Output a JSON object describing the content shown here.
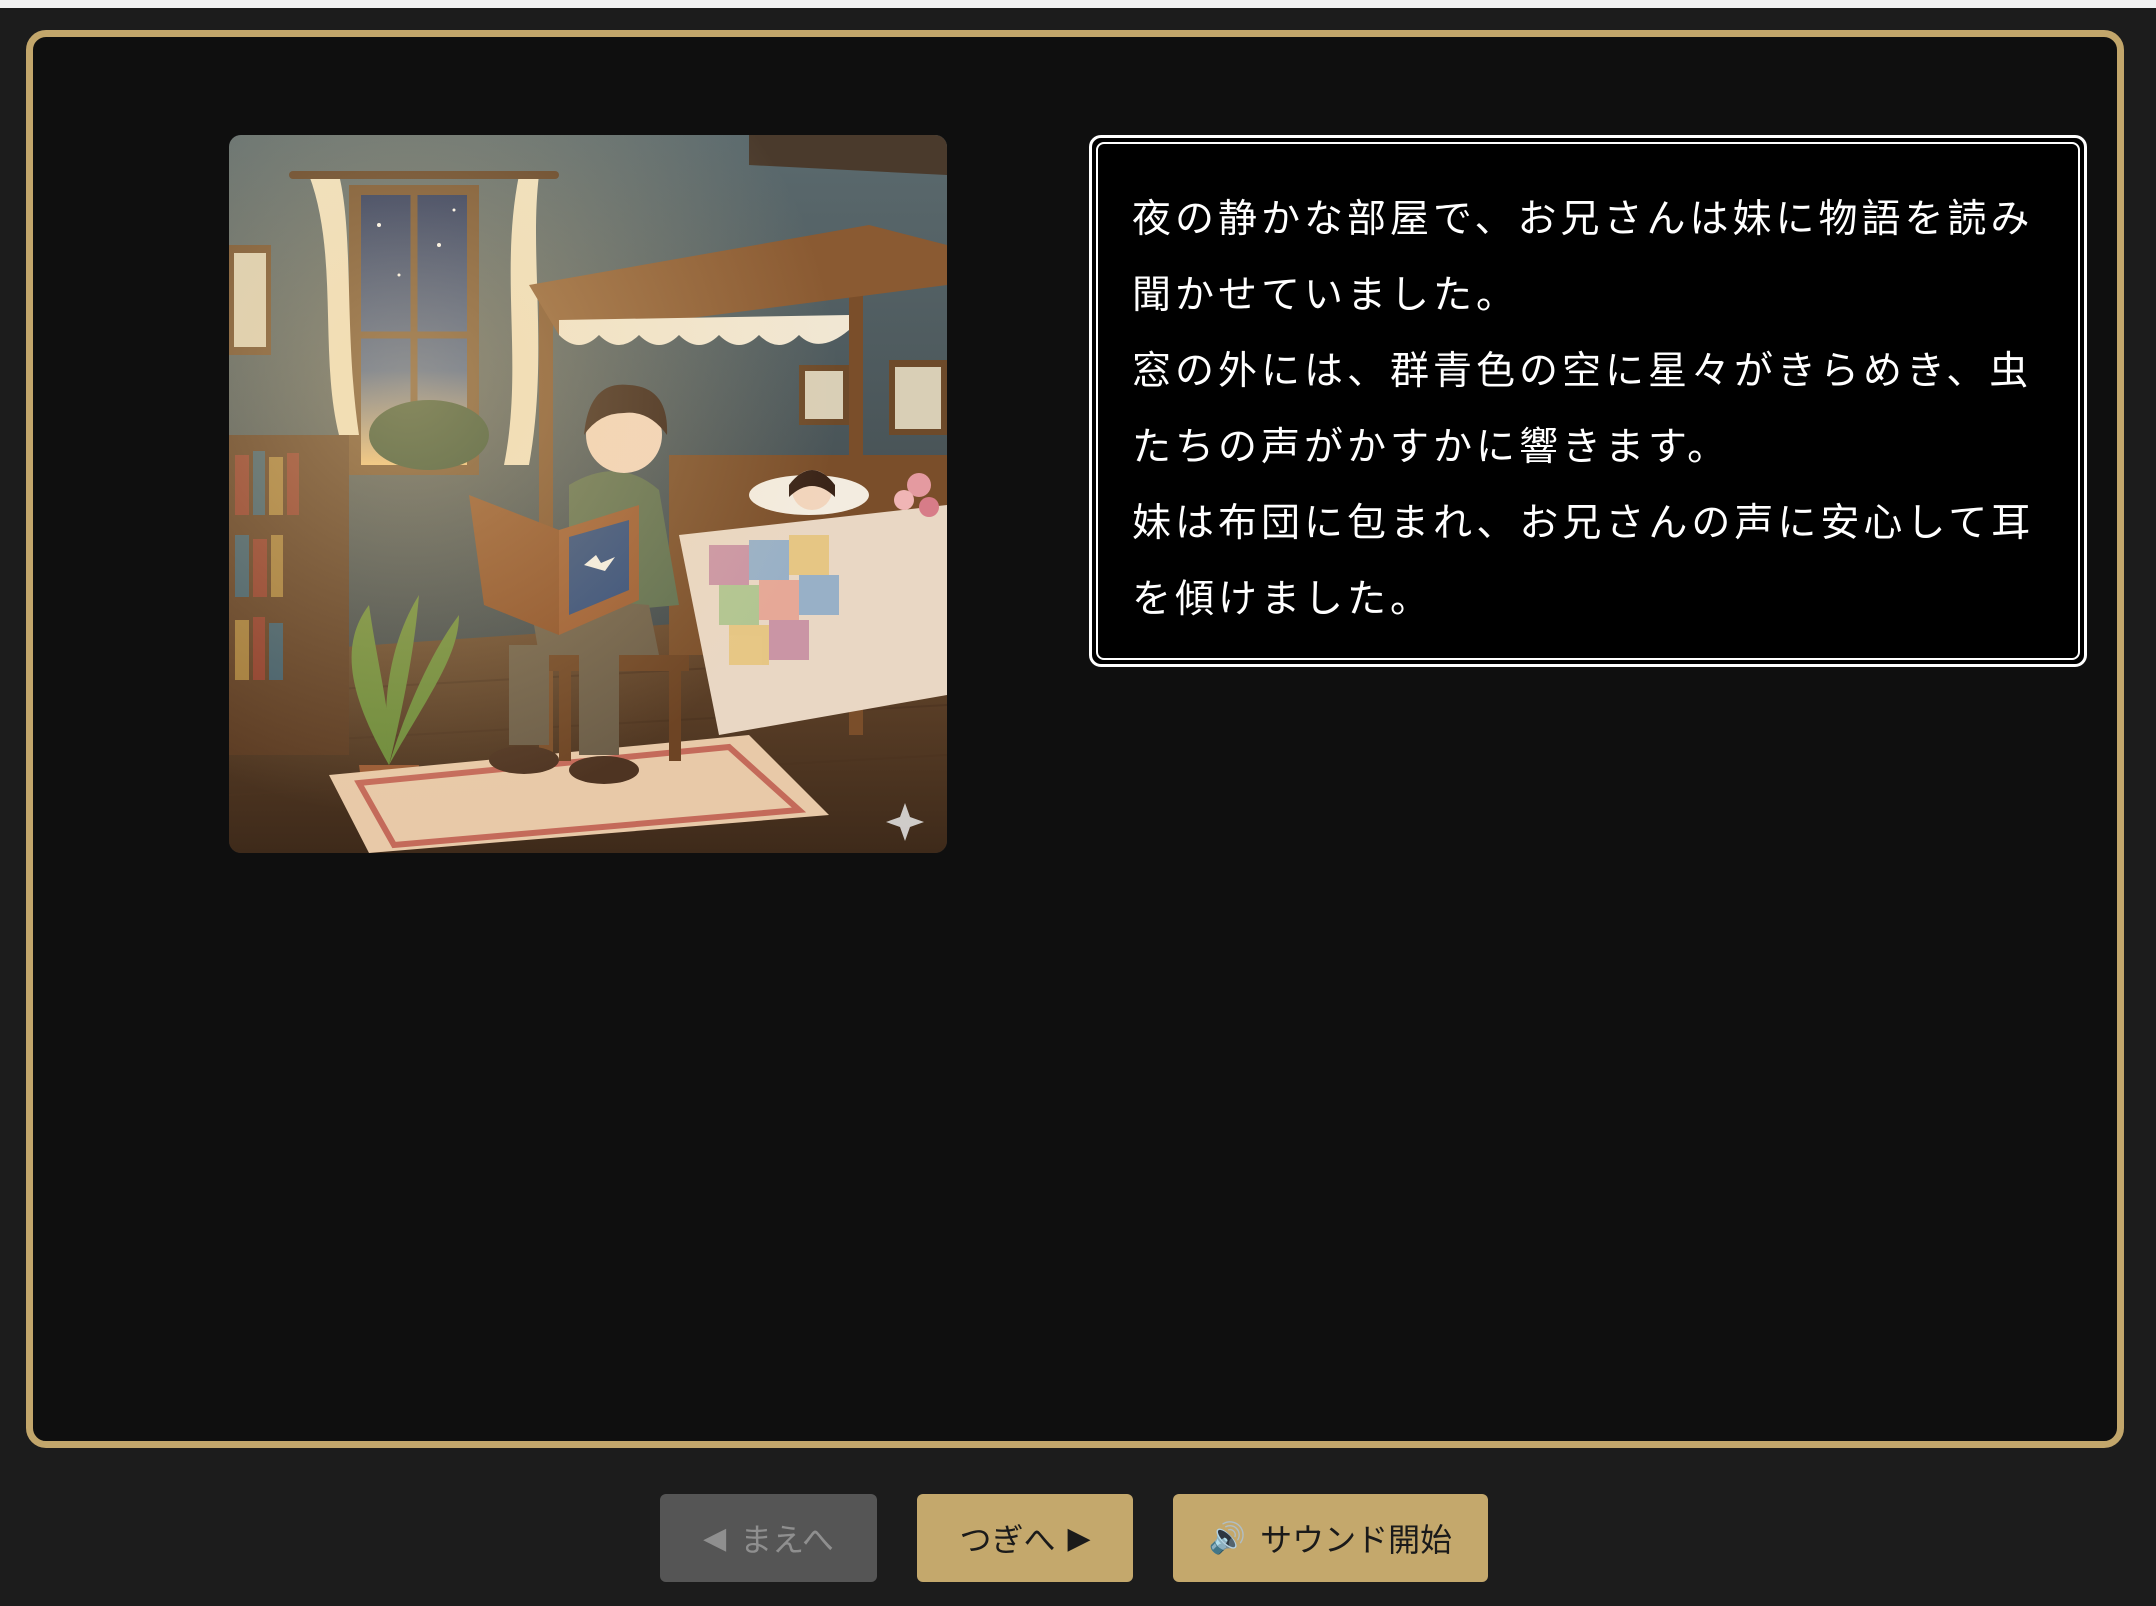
{
  "story": {
    "lines": [
      "夜の静かな部屋で、お兄さんは妹に物語を読み",
      "聞かせていました。",
      "窓の外には、群青色の空に星々がきらめき、虫",
      "たちの声がかすかに響きます。",
      "妹は布団に包まれ、お兄さんの声に安心して耳",
      "を傾けました。"
    ]
  },
  "controls": {
    "prev": {
      "icon": "◀",
      "label": "まえへ",
      "enabled": false
    },
    "next": {
      "icon": "▶",
      "label": "つぎへ",
      "enabled": true
    },
    "sound": {
      "icon": "🔊",
      "label": "サウンド開始",
      "enabled": true
    }
  },
  "theme": {
    "frame": "#c2a66b",
    "button": "#c4a86c",
    "button_disabled": "#555555",
    "stage_bg": "#0f0f0f",
    "page_bg": "#1c1c1c"
  }
}
